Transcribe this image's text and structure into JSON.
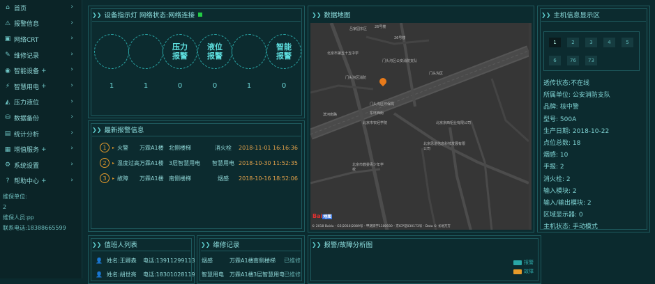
{
  "sidebar": {
    "items": [
      {
        "icon": "⌂",
        "label": "首页",
        "plus": ""
      },
      {
        "icon": "⚠",
        "label": "报警信息",
        "plus": ""
      },
      {
        "icon": "▣",
        "label": "网络CRT",
        "plus": ""
      },
      {
        "icon": "✎",
        "label": "维修记录",
        "plus": ""
      },
      {
        "icon": "◉",
        "label": "智能设备",
        "plus": "+"
      },
      {
        "icon": "⚡",
        "label": "智慧用电",
        "plus": "+"
      },
      {
        "icon": "◭",
        "label": "压力液位",
        "plus": ""
      },
      {
        "icon": "⛁",
        "label": "数据备份",
        "plus": ""
      },
      {
        "icon": "▤",
        "label": "统计分析",
        "plus": ""
      },
      {
        "icon": "▦",
        "label": "增值服务",
        "plus": "+"
      },
      {
        "icon": "⚙",
        "label": "系统设置",
        "plus": ""
      },
      {
        "icon": "?",
        "label": "帮助中心",
        "plus": "+"
      }
    ],
    "maint": [
      "维保单位:",
      "2",
      "维保人员:pp",
      "联系电话:18388665599"
    ]
  },
  "device": {
    "title": "设备指示灯 网络状态:网络连接",
    "circles": [
      {
        "label": "",
        "value": "1"
      },
      {
        "label": "",
        "value": "1"
      },
      {
        "label": "压力\n报警",
        "value": "0"
      },
      {
        "label": "液位\n报警",
        "value": "0"
      },
      {
        "label": "",
        "value": "1"
      },
      {
        "label": "智能\n报警",
        "value": "0"
      }
    ]
  },
  "alarms": {
    "title": "最新报警信息",
    "rows": [
      {
        "n": "1",
        "type": "火警",
        "bldg": "万霖A1楼",
        "loc": "北侧楼梯",
        "dev": "消火栓",
        "time": "2018-11-01 16:16:36"
      },
      {
        "n": "2",
        "type": "温度过高",
        "bldg": "万霖A1楼",
        "loc": "3层智慧用电",
        "dev": "智慧用电",
        "time": "2018-10-30 11:52:35"
      },
      {
        "n": "3",
        "type": "故障",
        "bldg": "万霖A1楼",
        "loc": "南侧楼梯",
        "dev": "烟感",
        "time": "2018-10-16 18:52:06"
      }
    ]
  },
  "map": {
    "title": "数据地图",
    "labels": [
      "吕家园东区",
      "26号楼",
      "26号楼",
      "北京市第五十五中学",
      "门头沟区公安消防支队",
      "门头沟区",
      "门头沟区消防",
      "门头沟区环保局",
      "东环西街",
      "滨河南路",
      "北京市农经学院",
      "北京京西铝业有限公司",
      "北京思道信息科技发展有限公司",
      "北京市教委青少年学校"
    ],
    "copyright": "© 2018 Baidu - GS(2016)2089号 - 甲测资字1100930 - 京ICP证030173号 - Data © 长地万方",
    "logo": "Bai",
    "logo2": "地图"
  },
  "host": {
    "title": "主机信息显示区",
    "cells": [
      "1",
      "2",
      "3",
      "4",
      "5",
      "6",
      "76",
      "73"
    ],
    "info": [
      "透传状态:不在线",
      "所属单位: 公安消防支队",
      "品牌: 核中警",
      "型号: 500A",
      "生产日期: 2018-10-22",
      "点位总数: 18",
      "烟感: 10",
      "手报: 2",
      "消火栓: 2",
      "输入模块: 2",
      "输入/输出模块: 2",
      "区域显示器: 0",
      "主机状态: 手动模式"
    ]
  },
  "duty": {
    "title": "值班人列表",
    "rows": [
      {
        "name": "姓名:王卿森",
        "phone": "电话:13911299113"
      },
      {
        "name": "姓名:胡世亮",
        "phone": "电话:18301028119"
      }
    ]
  },
  "repair": {
    "title": "维修记录",
    "rows": [
      {
        "dev": "烟感",
        "bldg": "万霖A1楼",
        "loc": "南侧楼梯",
        "status": "已维修"
      },
      {
        "dev": "智慧用电",
        "bldg": "万霖A1楼",
        "loc": "3层智慧用电",
        "status": "已维修"
      }
    ]
  },
  "analysis": {
    "title": "报警/故障分析图",
    "legend": [
      {
        "label": "报警",
        "color": "#2aa6a6"
      },
      {
        "label": "故障",
        "color": "#e69a2a"
      }
    ]
  },
  "colors": {
    "accent": "#2aa6a6",
    "alarm": "#e69a2a",
    "status_dot": "#22cc44"
  }
}
